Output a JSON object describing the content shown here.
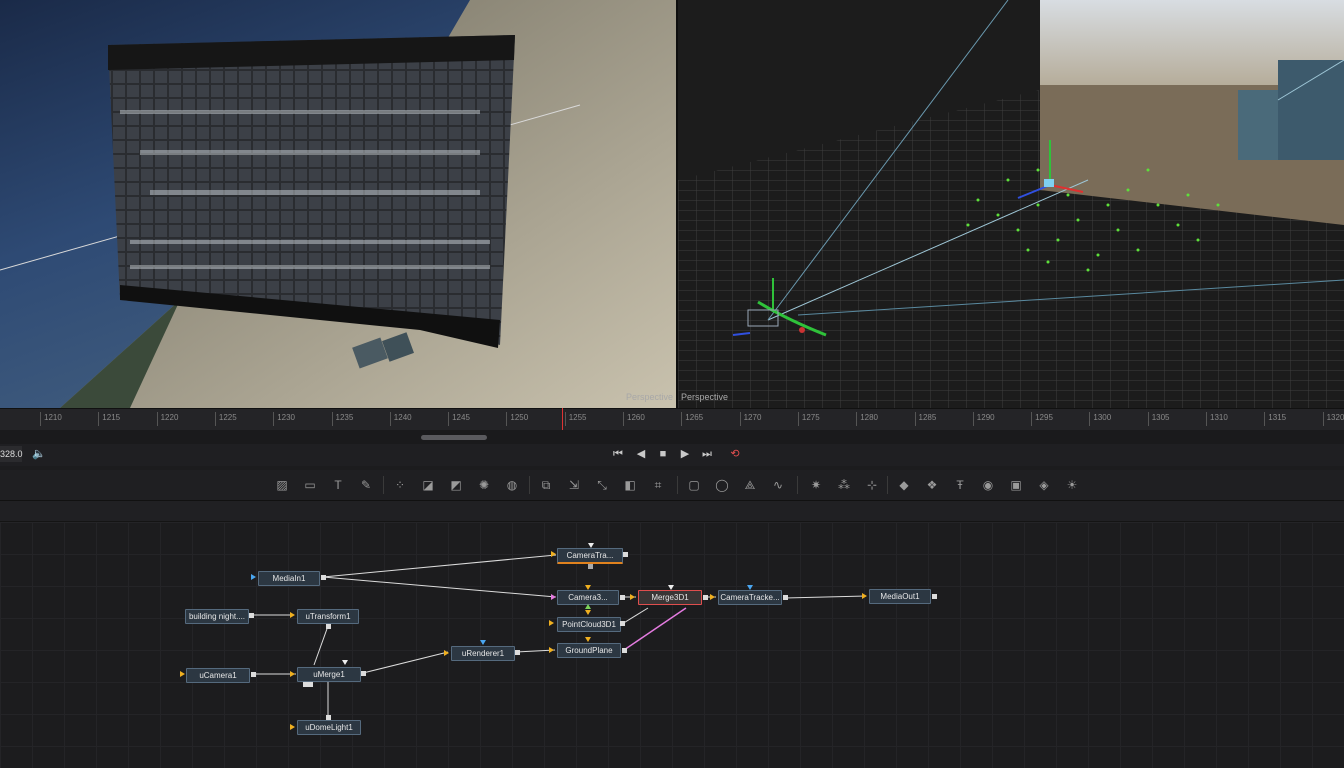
{
  "viewers": {
    "left_label": "Perspective",
    "right_label": "Perspective"
  },
  "timeline": {
    "ticks": [
      "1210",
      "1215",
      "1220",
      "1225",
      "1230",
      "1235",
      "1240",
      "1245",
      "1250",
      "1255",
      "1260",
      "1265",
      "1270",
      "1275",
      "1280",
      "1285",
      "1290",
      "1295",
      "1300",
      "1305",
      "1310",
      "1315",
      "1320"
    ],
    "current_frame": "328.0"
  },
  "transport": {
    "go_start": "⏮",
    "play_reverse": "◀",
    "stop": "■",
    "play_forward": "▶",
    "go_end": "⏭",
    "loop": "⟲",
    "audio": "🔈"
  },
  "toolbar": {
    "icons": [
      "background-icon",
      "image-plane-icon",
      "text-icon",
      "paint-brush-icon",
      "particles-icon",
      "gradient-icon",
      "color-corrector-icon",
      "brightness-icon",
      "blur-icon",
      "merge-icon",
      "transform-icon",
      "resize-icon",
      "mask-icon",
      "crop-icon",
      "rectangle-mask-icon",
      "ellipse-mask-icon",
      "polygon-mask-icon",
      "bspline-mask-icon",
      "particle-emitter-icon",
      "particle-render-icon",
      "tracker-icon",
      "shape3d-icon",
      "merge3d-icon",
      "text3d-icon",
      "camera3d-icon",
      "image-plane3d-icon",
      "renderer3d-icon",
      "light-icon"
    ]
  },
  "nodes": {
    "mediain": "MediaIn1",
    "camera_tracker_top": "CameraTra...",
    "camera3d": "Camera3...",
    "merge3d": "Merge3D1",
    "camera_tracker_right": "CameraTracke...",
    "mediaout": "MediaOut1",
    "building": "building night....",
    "utransform": "uTransform1",
    "pointcloud": "PointCloud3D1",
    "urenderer": "uRenderer1",
    "groundplane": "GroundPlane",
    "ucamera": "uCamera1",
    "umerge": "uMerge1",
    "udomelight": "uDomeLight1"
  },
  "colors": {
    "accent_red": "#e04e4e",
    "accent_orange": "#e0821e",
    "input_yellow": "#f0b020",
    "input_blue": "#4aa6f0",
    "pink_link": "#e47be0"
  }
}
